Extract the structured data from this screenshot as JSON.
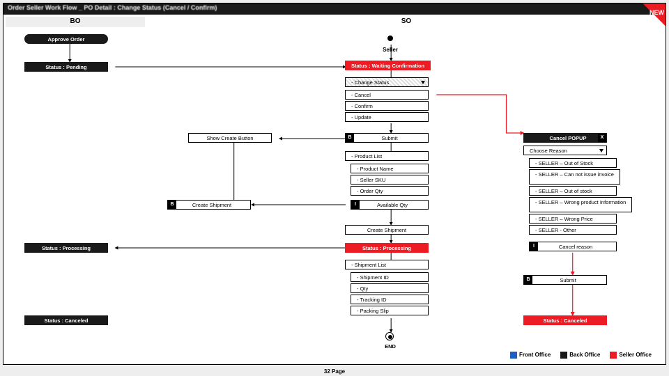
{
  "title": "Order Seller Work Flow _ PO Detail : Change Status (Cancel / Confirm)",
  "new_badge": "NEW",
  "columns": {
    "bo": "BO",
    "so": "SO"
  },
  "bo": {
    "approve": "Approve Order",
    "pending": "Status : Pending",
    "processing": "Status : Processing",
    "canceled": "Status : Canceled"
  },
  "seller_label": "Seller",
  "so": {
    "waiting": "Status : Waiting Confirmation",
    "change": "- Change Status",
    "cancel": "- Cancel",
    "confirm": "- Confirm",
    "update": "- Update",
    "show_create": "Show Create Button",
    "submit1": "Submit",
    "product_list": "- Product List",
    "product_name": "- Product Name",
    "seller_sku": "- Seller SKU",
    "order_qty": "- Order Qty",
    "available_qty": "Available Qty",
    "create_ship_btn": "Create Shipment",
    "create_ship": "Create Shipment",
    "processing": "Status : Processing",
    "ship_list": "- Shipment List",
    "ship_id": "- Shipment ID",
    "qty": "- Qty",
    "tracking": "- Tracking ID",
    "packing": "- Packing Slip",
    "end": "END"
  },
  "popup": {
    "title": "Cancel POPUP",
    "x": "X",
    "choose": "Choose Reason",
    "r1": "- SELLER – Out of Stock",
    "r2": "- SELLER – Can not issue invoice",
    "r3": "- SELLER – Out of stock",
    "r4": "- SELLER – Wrong product Information",
    "r5": "- SELLER – Wrong Price",
    "r6": "- SELLER - Other",
    "cancel_reason": "Cancel reason",
    "submit": "Submit",
    "canceled": "Status : Canceled"
  },
  "legend": {
    "front": "Front Office",
    "back": "Back Office",
    "seller": "Seller Office"
  },
  "footer": "32 Page",
  "colors": {
    "red": "#ed1c24",
    "black": "#1a1a1a",
    "blue": "#1f5fbf"
  }
}
